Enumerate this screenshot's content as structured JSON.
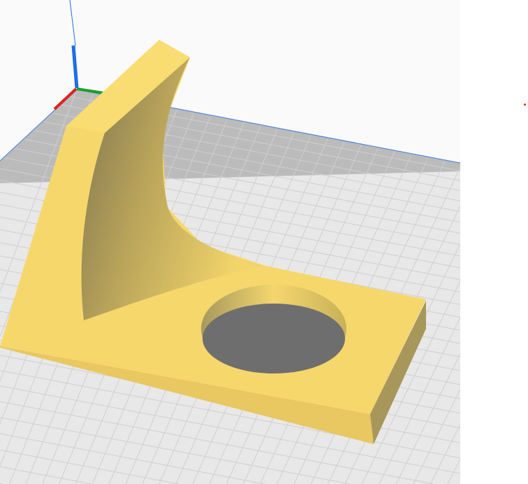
{
  "viewport": {
    "colors": {
      "background": "#fafafa",
      "plate": "#e6e6e6",
      "grid": "#c9c9c9",
      "plate_edge": "#9a9a9a",
      "model": "#f6d76b",
      "model_shadow": "#8c7f4f",
      "axis_x": "#e02020",
      "axis_y": "#1aa02a",
      "axis_z": "#1a6ee8"
    }
  }
}
